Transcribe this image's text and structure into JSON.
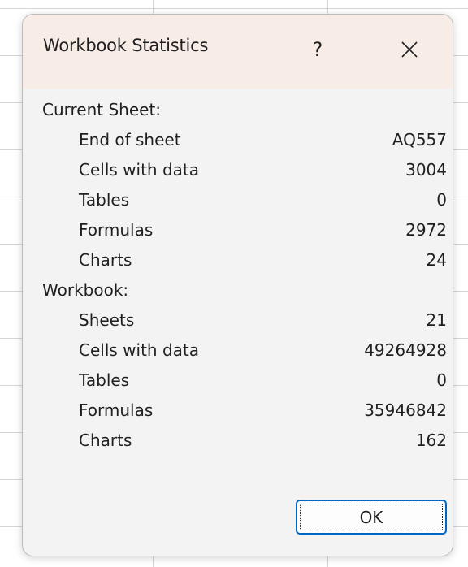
{
  "dialog": {
    "title": "Workbook Statistics",
    "help_label": "?",
    "close_icon": "close-icon",
    "ok_label": "OK"
  },
  "current_sheet": {
    "heading": "Current Sheet:",
    "rows": [
      {
        "label": "End of sheet",
        "value": "AQ557"
      },
      {
        "label": "Cells with data",
        "value": "3004"
      },
      {
        "label": "Tables",
        "value": "0"
      },
      {
        "label": "Formulas",
        "value": "2972"
      },
      {
        "label": "Charts",
        "value": "24"
      }
    ]
  },
  "workbook": {
    "heading": "Workbook:",
    "rows": [
      {
        "label": "Sheets",
        "value": "21"
      },
      {
        "label": "Cells with data",
        "value": "49264928"
      },
      {
        "label": "Tables",
        "value": "0"
      },
      {
        "label": "Formulas",
        "value": "35946842"
      },
      {
        "label": "Charts",
        "value": "162"
      }
    ]
  },
  "colors": {
    "titlebar_bg": "#f8ece6",
    "dialog_bg": "#f3f3f3",
    "accent": "#0067c0"
  }
}
